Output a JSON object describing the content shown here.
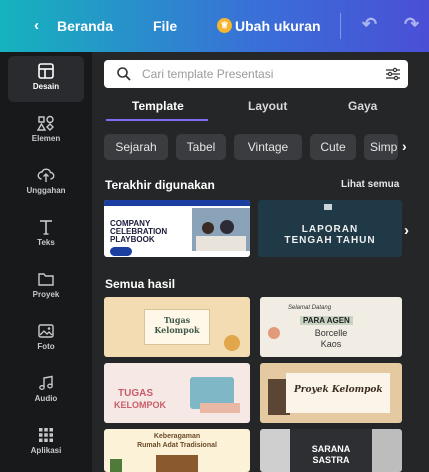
{
  "topbar": {
    "back_label": "Beranda",
    "file_label": "File",
    "resize_label": "Ubah ukuran"
  },
  "sidebar": {
    "items": [
      {
        "label": "Desain",
        "icon": "layout-icon"
      },
      {
        "label": "Elemen",
        "icon": "shapes-icon"
      },
      {
        "label": "Unggahan",
        "icon": "cloud-upload-icon"
      },
      {
        "label": "Teks",
        "icon": "text-icon"
      },
      {
        "label": "Proyek",
        "icon": "folder-icon"
      },
      {
        "label": "Foto",
        "icon": "image-icon"
      },
      {
        "label": "Audio",
        "icon": "music-note-icon"
      },
      {
        "label": "Aplikasi",
        "icon": "apps-grid-icon"
      }
    ]
  },
  "search": {
    "placeholder": "Cari template Presentasi"
  },
  "tabs": [
    {
      "label": "Template",
      "active": true
    },
    {
      "label": "Layout",
      "active": false
    },
    {
      "label": "Gaya",
      "active": false
    }
  ],
  "chips": [
    "Sejarah",
    "Tabel",
    "Vintage",
    "Cute",
    "Simp"
  ],
  "recent": {
    "title": "Terakhir digunakan",
    "see_all": "Lihat semua",
    "items": [
      {
        "line1": "COMPANY",
        "line2": "CELEBRATION",
        "line3": "PLAYBOOK"
      },
      {
        "line1": "LAPORAN",
        "line2": "TENGAH TAHUN"
      }
    ]
  },
  "all_results": {
    "title": "Semua hasil",
    "items": [
      {
        "line1": "Tugas",
        "line2": "Kelompok"
      },
      {
        "line1": "Selamat Datang",
        "line2": "PARA AGEN",
        "line3": "Borcelle",
        "line4": "Kaos"
      },
      {
        "line1": "TUGAS",
        "line2": "KELOMPOK"
      },
      {
        "line1": "Proyek Kelompok"
      },
      {
        "line1": "Keberagaman",
        "line2": "Rumah Adat Tradisional"
      },
      {
        "line1": "SARANA",
        "line2": "SASTRA"
      }
    ]
  },
  "colors": {
    "topbar_start": "#15b3bd",
    "topbar_end": "#4a4fd6",
    "accent": "#7b6cf6",
    "panel_bg": "#252627",
    "sidebar_bg": "#18191b"
  }
}
